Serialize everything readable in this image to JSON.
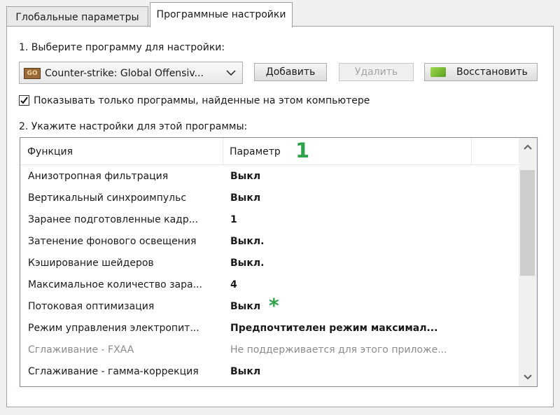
{
  "tabs": [
    {
      "label": "Глобальные параметры",
      "active": false
    },
    {
      "label": "Программные настройки",
      "active": true
    }
  ],
  "step1_label": "1. Выберите программу для настройки:",
  "program_select": {
    "icon_text": "GO",
    "value": "Counter-strike: Global Offensiv..."
  },
  "buttons": {
    "add": "Добавить",
    "remove": "Удалить",
    "restore": "Восстановить"
  },
  "show_only_checkbox": {
    "checked": true,
    "label": "Показывать только программы, найденные на этом компьютере"
  },
  "step2_label": "2. Укажите настройки для этой программы:",
  "grid": {
    "columns": [
      "Функция",
      "Параметр"
    ],
    "callout_1": "1",
    "callout_asterisk": "*",
    "rows": [
      {
        "feature": "Анизотропная фильтрация",
        "value": "Выкл"
      },
      {
        "feature": "Вертикальный синхроимпульс",
        "value": "Выкл"
      },
      {
        "feature": "Заранее подготовленные кадр...",
        "value": "1"
      },
      {
        "feature": "Затенение фонового освещения",
        "value": "Выкл."
      },
      {
        "feature": "Кэширование шейдеров",
        "value": "Выкл."
      },
      {
        "feature": "Максимальное количество зара...",
        "value": "4"
      },
      {
        "feature": "Потоковая оптимизация",
        "value": "Выкл"
      },
      {
        "feature": "Режим управления электропит...",
        "value": "Предпочтителен режим максимал..."
      },
      {
        "feature": "Сглаживание - FXAA",
        "value": "Не поддерживается для этого приложе..."
      },
      {
        "feature": "Сглаживание - гамма-коррекция",
        "value": "Выкл"
      }
    ]
  },
  "colors": {
    "accent_green": "#2aa34a",
    "disabled_text": "#8c8c8c"
  }
}
